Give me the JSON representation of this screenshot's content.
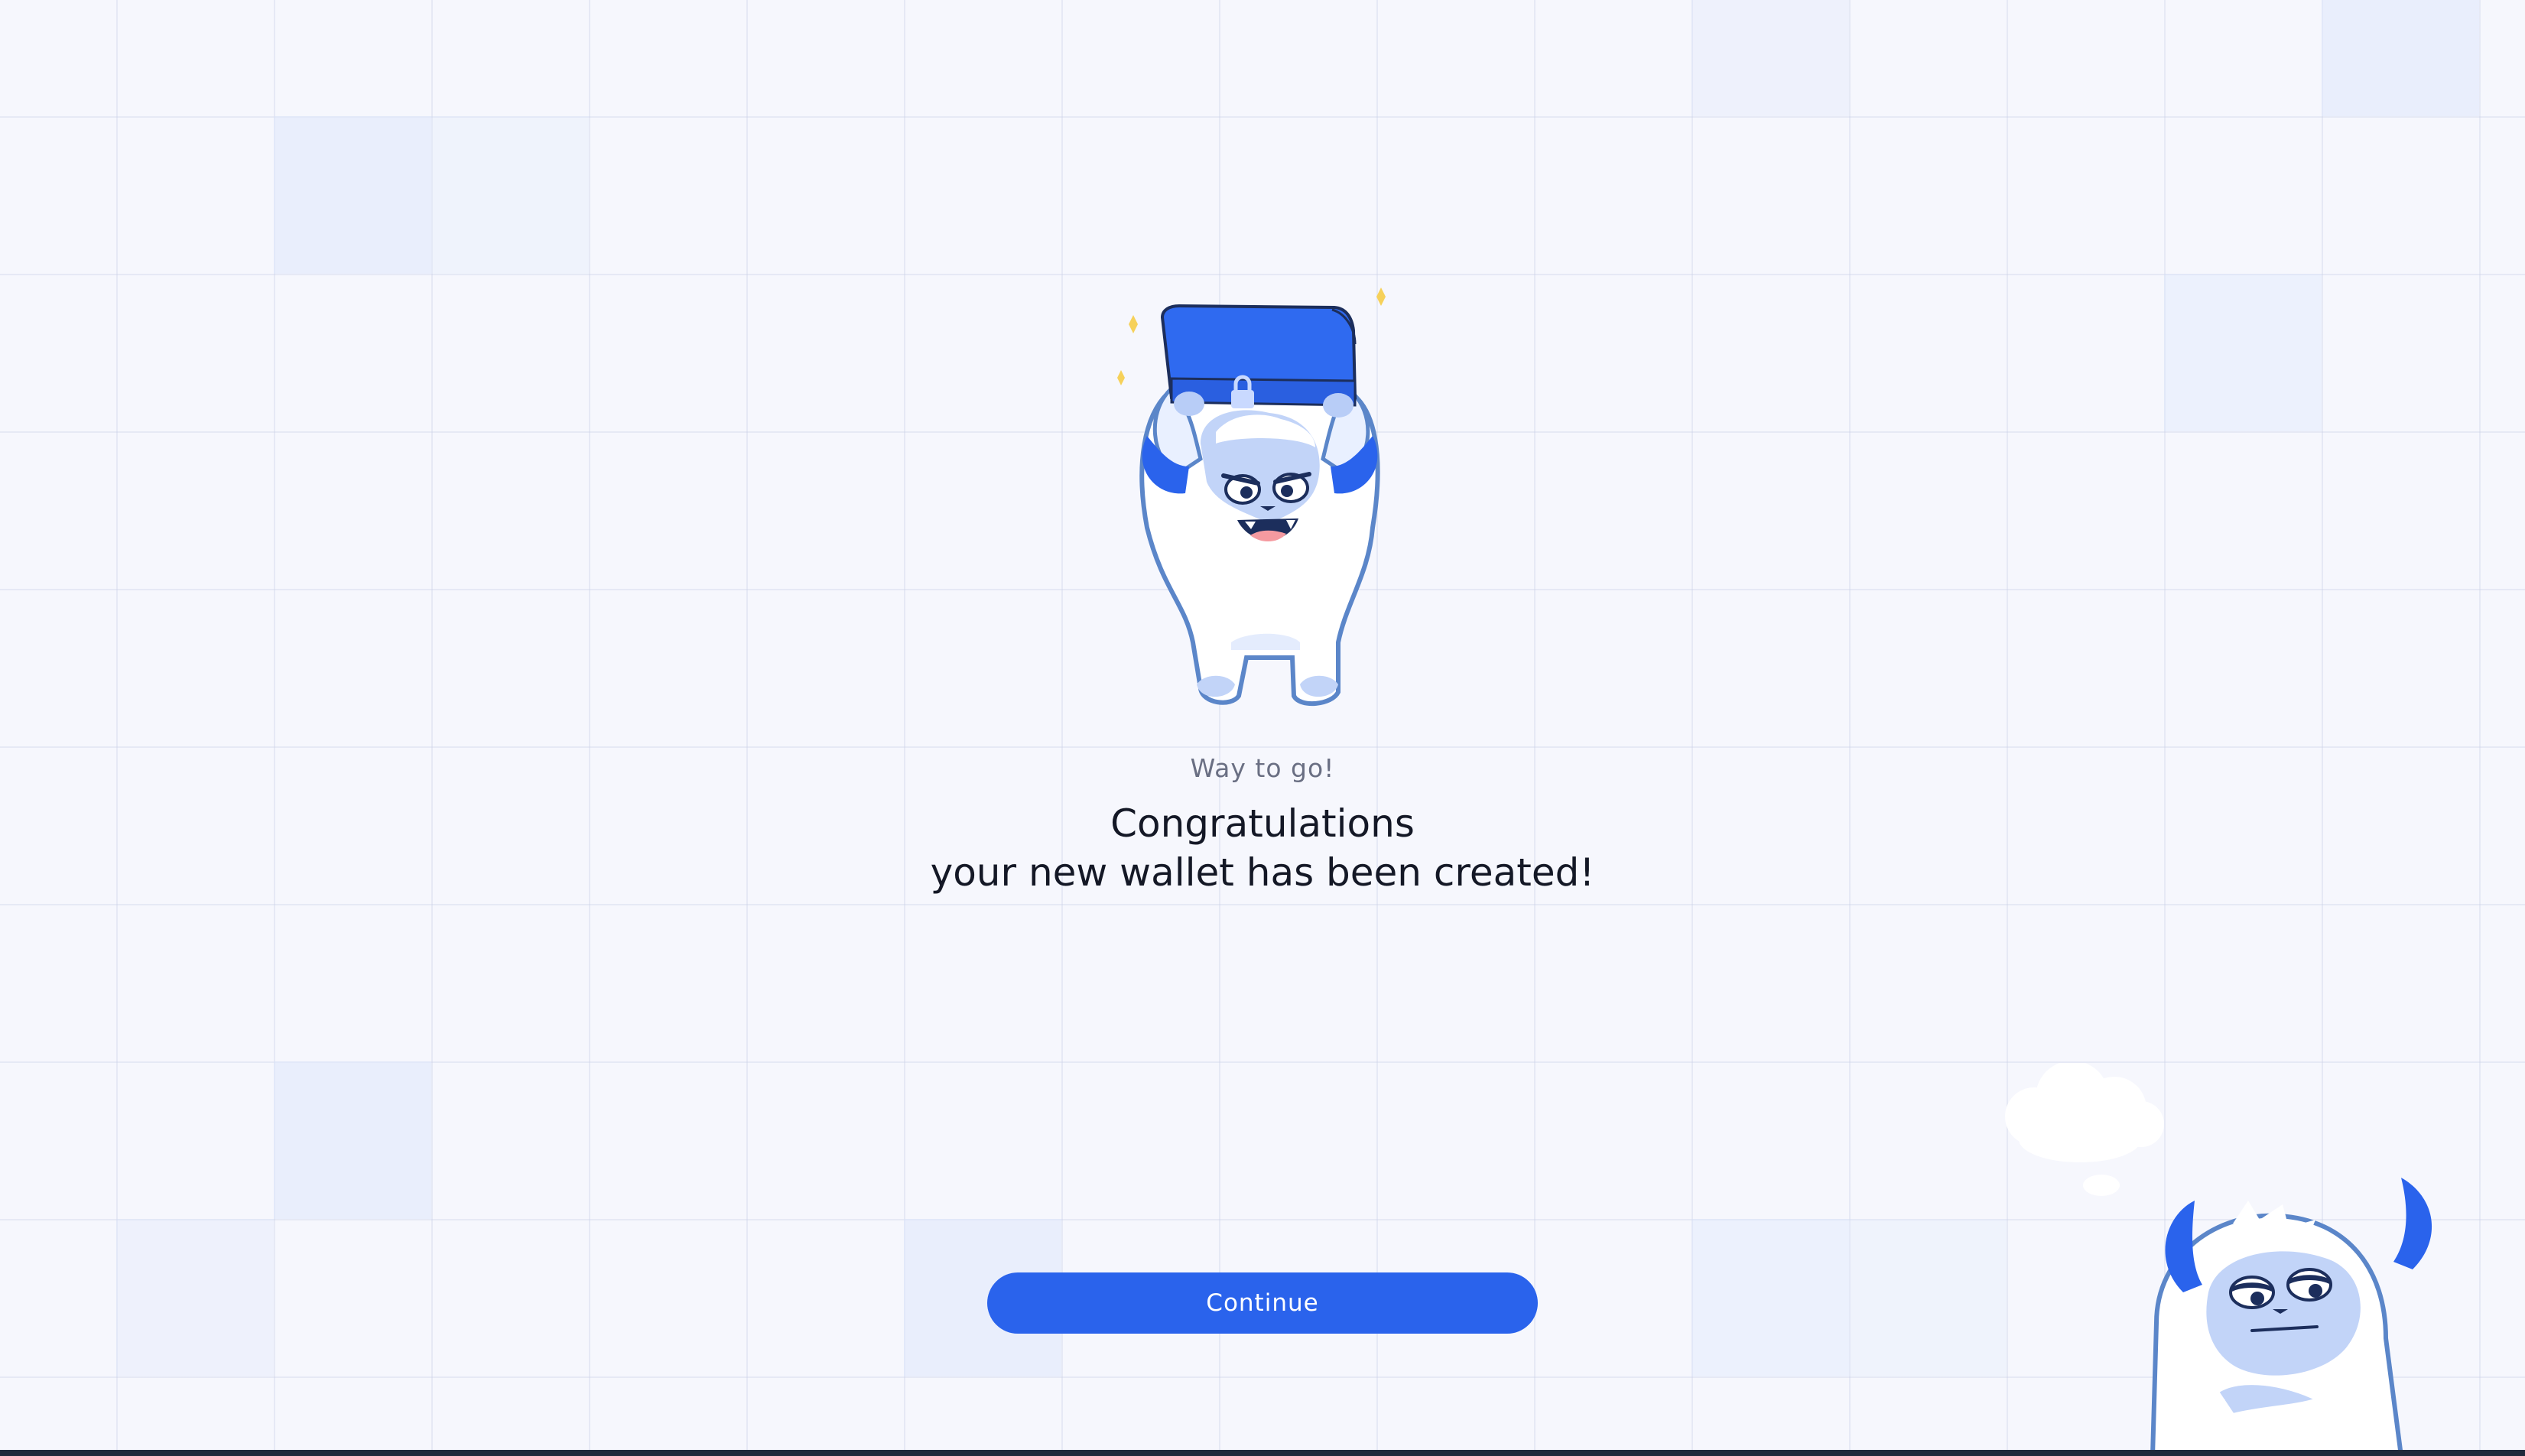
{
  "screen": {
    "subtitle": "Way to go!",
    "headline_line1": "Congratulations",
    "headline_line2": "your new wallet has been created!"
  },
  "actions": {
    "continue_label": "Continue"
  },
  "theme": {
    "accent": "#2a63ec",
    "background": "#f6f7fd",
    "text_primary": "#141826",
    "text_secondary": "#6a6f83"
  },
  "icons": {
    "hero": "yeti-holding-chest-illustration",
    "corner": "yeti-thinking-illustration"
  }
}
